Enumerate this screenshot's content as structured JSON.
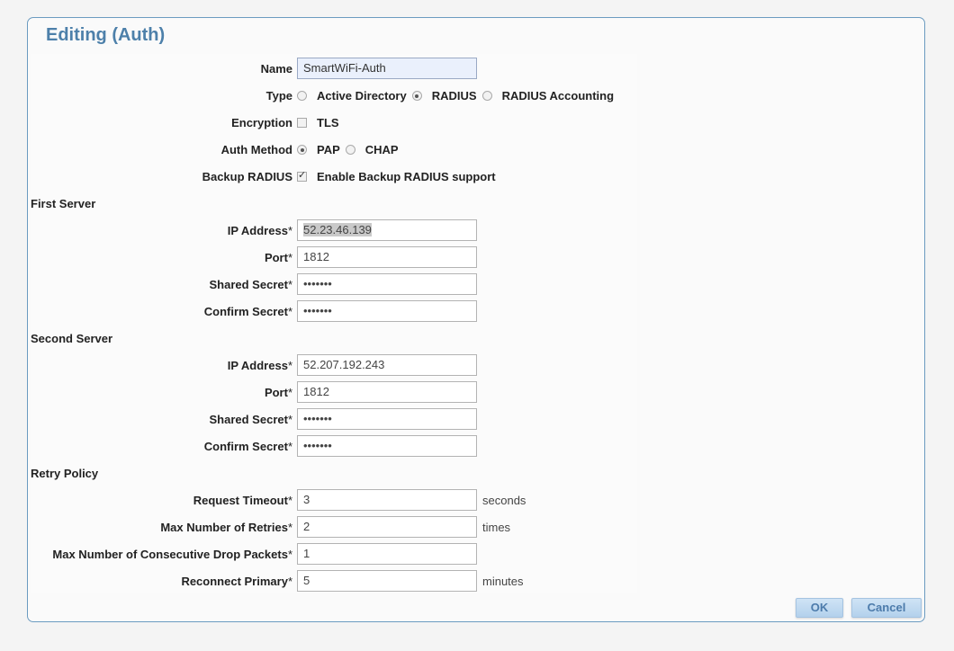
{
  "dialog": {
    "title": "Editing (Auth)"
  },
  "name": {
    "label": "Name",
    "value": "SmartWiFi-Auth"
  },
  "type": {
    "label": "Type",
    "options": [
      "Active Directory",
      "RADIUS",
      "RADIUS Accounting"
    ],
    "selected": "RADIUS"
  },
  "encryption": {
    "label": "Encryption",
    "option": "TLS",
    "checked": false
  },
  "auth_method": {
    "label": "Auth Method",
    "options": [
      "PAP",
      "CHAP"
    ],
    "selected": "PAP"
  },
  "backup_radius": {
    "label": "Backup RADIUS",
    "option": "Enable Backup RADIUS support",
    "checked": true
  },
  "first_server": {
    "heading": "First Server",
    "ip_label": "IP Address",
    "ip_value": "52.23.46.139",
    "port_label": "Port",
    "port_value": "1812",
    "secret_label": "Shared Secret",
    "secret_value": "•••••••",
    "confirm_label": "Confirm Secret",
    "confirm_value": "•••••••"
  },
  "second_server": {
    "heading": "Second Server",
    "ip_label": "IP Address",
    "ip_value": "52.207.192.243",
    "port_label": "Port",
    "port_value": "1812",
    "secret_label": "Shared Secret",
    "secret_value": "•••••••",
    "confirm_label": "Confirm Secret",
    "confirm_value": "•••••••"
  },
  "retry": {
    "heading": "Retry Policy",
    "timeout_label": "Request Timeout",
    "timeout_value": "3",
    "timeout_unit": "seconds",
    "retries_label": "Max Number of Retries",
    "retries_value": "2",
    "retries_unit": "times",
    "drops_label": "Max Number of Consecutive Drop Packets",
    "drops_value": "1",
    "reconnect_label": "Reconnect Primary",
    "reconnect_value": "5",
    "reconnect_unit": "minutes"
  },
  "required_marker": "*",
  "buttons": {
    "ok": "OK",
    "cancel": "Cancel"
  },
  "colors": {
    "title": "#4d80aa",
    "border": "#6b9bc0",
    "button_text": "#4c7bab"
  }
}
